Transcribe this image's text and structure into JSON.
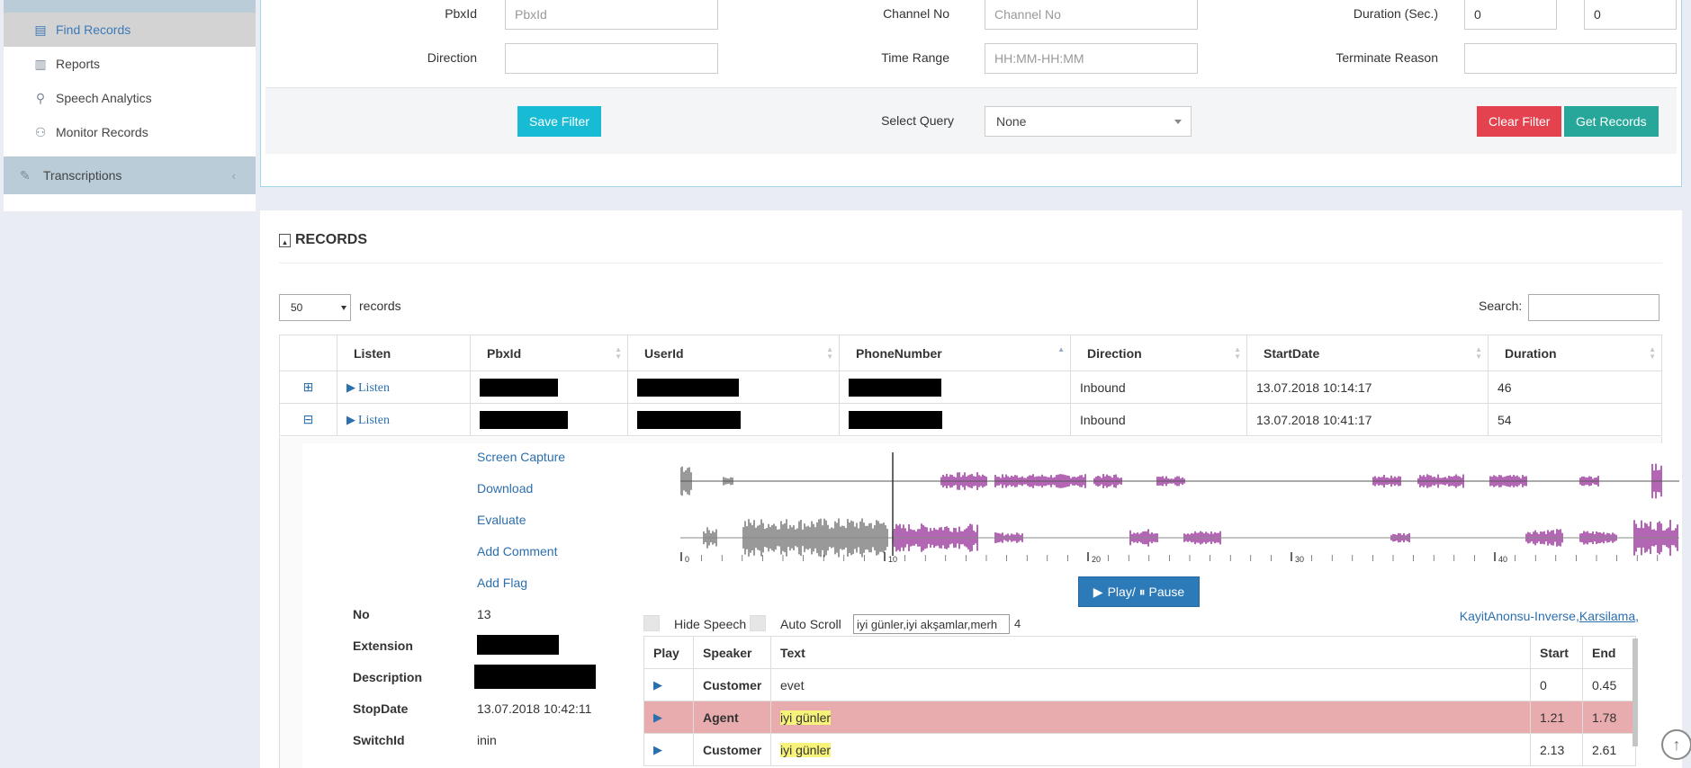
{
  "sidebar": {
    "items": [
      {
        "label": "Find Records",
        "icon": "document-chart-icon",
        "active": true
      },
      {
        "label": "Reports",
        "icon": "bar-chart-icon",
        "active": false
      },
      {
        "label": "Speech Analytics",
        "icon": "search-icon",
        "active": false
      },
      {
        "label": "Monitor Records",
        "icon": "binoculars-icon",
        "active": false
      }
    ],
    "section": {
      "label": "Transcriptions",
      "icon": "pencil-icon"
    }
  },
  "filters": {
    "pbxid": {
      "label": "PbxId",
      "placeholder": "PbxId"
    },
    "channel_no": {
      "label": "Channel No",
      "placeholder": "Channel No"
    },
    "duration": {
      "label": "Duration (Sec.)",
      "min": "0",
      "max": "0"
    },
    "direction": {
      "label": "Direction",
      "value": ""
    },
    "time_range": {
      "label": "Time Range",
      "placeholder": "HH:MM-HH:MM"
    },
    "terminate_reason": {
      "label": "Terminate Reason",
      "value": ""
    },
    "save_filter": "Save Filter",
    "select_query_label": "Select Query",
    "select_query_value": "None",
    "clear_filter": "Clear Filter",
    "get_records": "Get Records"
  },
  "records": {
    "title": "RECORDS",
    "page_length": "50",
    "page_length_label": "records",
    "search_label": "Search:",
    "columns": [
      "Listen",
      "PbxId",
      "UserId",
      "PhoneNumber",
      "Direction",
      "StartDate",
      "Duration"
    ],
    "rows": [
      {
        "expand": "⊞",
        "listen": "Listen",
        "direction": "Inbound",
        "start_date": "13.07.2018 10:14:17",
        "duration": "46"
      },
      {
        "expand": "⊟",
        "listen": "Listen",
        "direction": "Inbound",
        "start_date": "13.07.2018 10:41:17",
        "duration": "54"
      }
    ]
  },
  "detail": {
    "actions": [
      "Screen Capture",
      "Download",
      "Evaluate",
      "Add Comment",
      "Add Flag"
    ],
    "info": [
      {
        "key": "No",
        "value": "13"
      },
      {
        "key": "Extension",
        "value": ""
      },
      {
        "key": "Description",
        "value": ""
      },
      {
        "key": "StopDate",
        "value": "13.07.2018 10:42:11"
      },
      {
        "key": "SwitchId",
        "value": "inin"
      }
    ],
    "timeline_ticks": [
      "0",
      "10",
      "20",
      "30",
      "40"
    ],
    "play_pause": "Play/ ⏸ Pause",
    "hide_speech": "Hide Speech",
    "auto_scroll": "Auto Scroll",
    "keywords_value": "iyi günler,iyi akşamlar,merh",
    "keywords_count": "4",
    "keyword_link_1": "KayitAnonsu-Inverse,",
    "keyword_link_2": "Karsilama",
    "keyword_link_3": ",",
    "speech_columns": [
      "Play",
      "Speaker",
      "Text",
      "Start",
      "End"
    ],
    "speech_rows": [
      {
        "speaker": "Customer",
        "text": "evet",
        "start": "0",
        "end": "0.45",
        "highlight": false,
        "kw": false
      },
      {
        "speaker": "Agent",
        "text": "iyi günler",
        "start": "1.21",
        "end": "1.78",
        "highlight": true,
        "kw": true
      },
      {
        "speaker": "Customer",
        "text": "iyi günler",
        "start": "2.13",
        "end": "2.61",
        "highlight": false,
        "kw": true
      }
    ]
  },
  "colors": {
    "accent": "#2c6fad",
    "cyan": "#17bcd4",
    "red": "#e3424e",
    "teal": "#27a79a",
    "row_highlight": "#e8abae",
    "wave_played": "#555555",
    "wave_unplayed": "#800080"
  }
}
